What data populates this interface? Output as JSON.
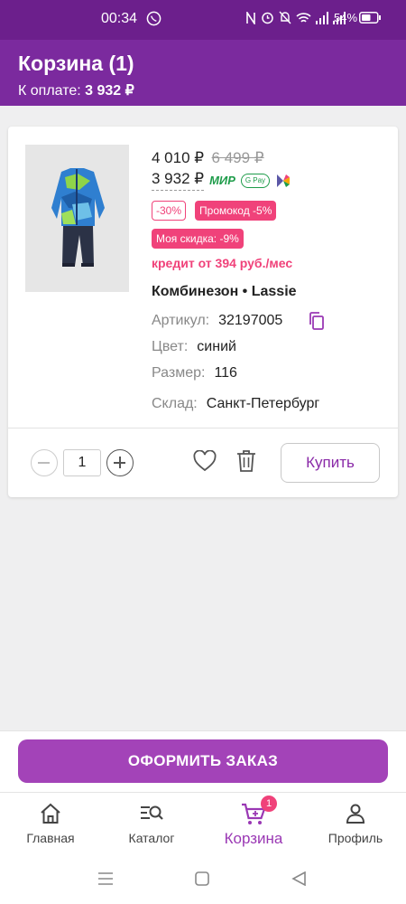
{
  "status_bar": {
    "time": "00:34",
    "battery_percent": "54%"
  },
  "header": {
    "title": "Корзина (1)",
    "total_label": "К оплате:",
    "total_value": "3 932 ₽"
  },
  "product": {
    "price_current": "4 010 ₽",
    "price_old": "6 499 ₽",
    "price_final": "3 932 ₽",
    "payment_mir": "МИР",
    "payment_gpay": "G Pay",
    "discount_badge": "-30%",
    "promo_badge": "Промокод -5%",
    "my_discount_badge": "Моя скидка: -9%",
    "credit_text": "кредит от 394 руб./мес",
    "name": "Комбинезон • Lassie",
    "article_label": "Артикул:",
    "article_value": "32197005",
    "color_label": "Цвет:",
    "color_value": "синий",
    "size_label": "Размер:",
    "size_value": "116",
    "warehouse_label": "Склад:",
    "warehouse_value": "Санкт-Петербург",
    "quantity": "1",
    "buy_label": "Купить"
  },
  "checkout": {
    "order_label": "ОФОРМИТЬ ЗАКАЗ"
  },
  "tabbar": {
    "items": [
      {
        "label": "Главная",
        "icon": "home-icon"
      },
      {
        "label": "Каталог",
        "icon": "catalog-search-icon"
      },
      {
        "label": "Корзина",
        "icon": "cart-icon",
        "badge": "1",
        "active": true
      },
      {
        "label": "Профиль",
        "icon": "profile-icon"
      }
    ]
  },
  "colors": {
    "brand_dark": "#6c1f8c",
    "brand": "#7b2a9e",
    "accent_pink": "#f0427a",
    "button_purple": "#a343b8",
    "mir_green": "#1e9c4a"
  }
}
